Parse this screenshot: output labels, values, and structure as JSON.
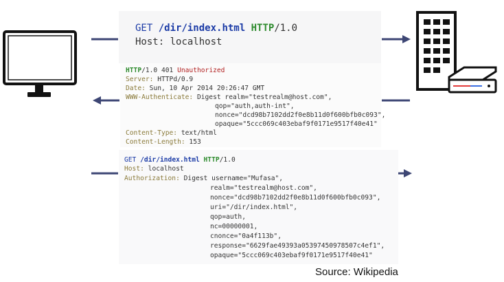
{
  "request1": {
    "method": "GET",
    "path": "/dir/index.html",
    "proto": "HTTP",
    "version": "/1.0",
    "host_label": "Host:",
    "host_value": "localhost"
  },
  "response": {
    "proto": "HTTP",
    "version": "/1.0 401",
    "status": "Unauthorized",
    "server_label": "Server:",
    "server_value": "HTTPd/0.9",
    "date_label": "Date:",
    "date_value": "Sun, 10 Apr 2014 20:26:47 GMT",
    "www_auth_label": "WWW-Authenticate:",
    "www_auth_lines": [
      "Digest realm=\"testrealm@host.com\",",
      "qop=\"auth,auth-int\",",
      "nonce=\"dcd98b7102dd2f0e8b11d0f600bfb0c093\",",
      "opaque=\"5ccc069c403ebaf9f0171e9517f40e41\""
    ],
    "content_type_label": "Content-Type:",
    "content_type_value": "text/html",
    "content_length_label": "Content-Length:",
    "content_length_value": "153"
  },
  "request2": {
    "method": "GET",
    "path": "/dir/index.html",
    "proto": "HTTP",
    "version": "/1.0",
    "host_label": "Host:",
    "host_value": "localhost",
    "auth_label": "Authorization:",
    "auth_lines": [
      "Digest username=\"Mufasa\",",
      "realm=\"testrealm@host.com\",",
      "nonce=\"dcd98b7102dd2f0e8b11d0f600bfb0c093\",",
      "uri=\"/dir/index.html\",",
      "qop=auth,",
      "nc=00000001,",
      "cnonce=\"0a4f113b\",",
      "response=\"6629fae49393a05397450978507c4ef1\",",
      "opaque=\"5ccc069c403ebaf9f0171e9517f40e41\""
    ]
  },
  "source": "Source: Wikipedia",
  "colors": {
    "arrow": "#3d4674",
    "keyword_blue": "#1a3aa6",
    "keyword_green": "#2e8b2e",
    "status_red": "#b22222",
    "header_olive": "#8a7a3a"
  },
  "icons": [
    "client-computer-icon",
    "server-building-icon"
  ]
}
